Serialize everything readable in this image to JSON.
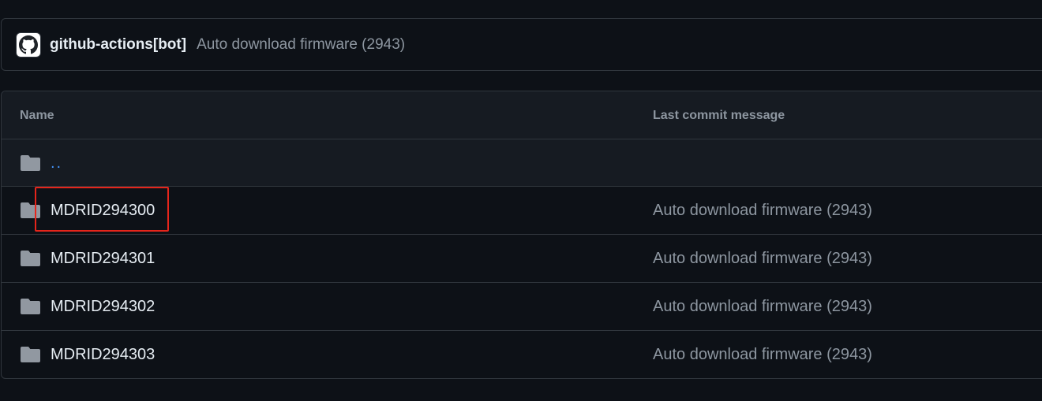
{
  "commit_bar": {
    "avatar_icon": "github-mark-icon",
    "author": "github-actions[bot]",
    "message": "Auto download firmware (2943)"
  },
  "table": {
    "columns": {
      "name": "Name",
      "last_commit_message": "Last commit message"
    },
    "parent_link": "..",
    "rows": [
      {
        "name": "MDRID294300",
        "message": "Auto download firmware (2943)",
        "icon": "folder-icon"
      },
      {
        "name": "MDRID294301",
        "message": "Auto download firmware (2943)",
        "icon": "folder-icon"
      },
      {
        "name": "MDRID294302",
        "message": "Auto download firmware (2943)",
        "icon": "folder-icon"
      },
      {
        "name": "MDRID294303",
        "message": "Auto download firmware (2943)",
        "icon": "folder-icon"
      }
    ]
  },
  "colors": {
    "background": "#0d1117",
    "header_background": "#161b22",
    "border": "#30363d",
    "link": "#4493f8",
    "muted_text": "#8d96a0",
    "annotation_highlight": "#e5251b"
  }
}
